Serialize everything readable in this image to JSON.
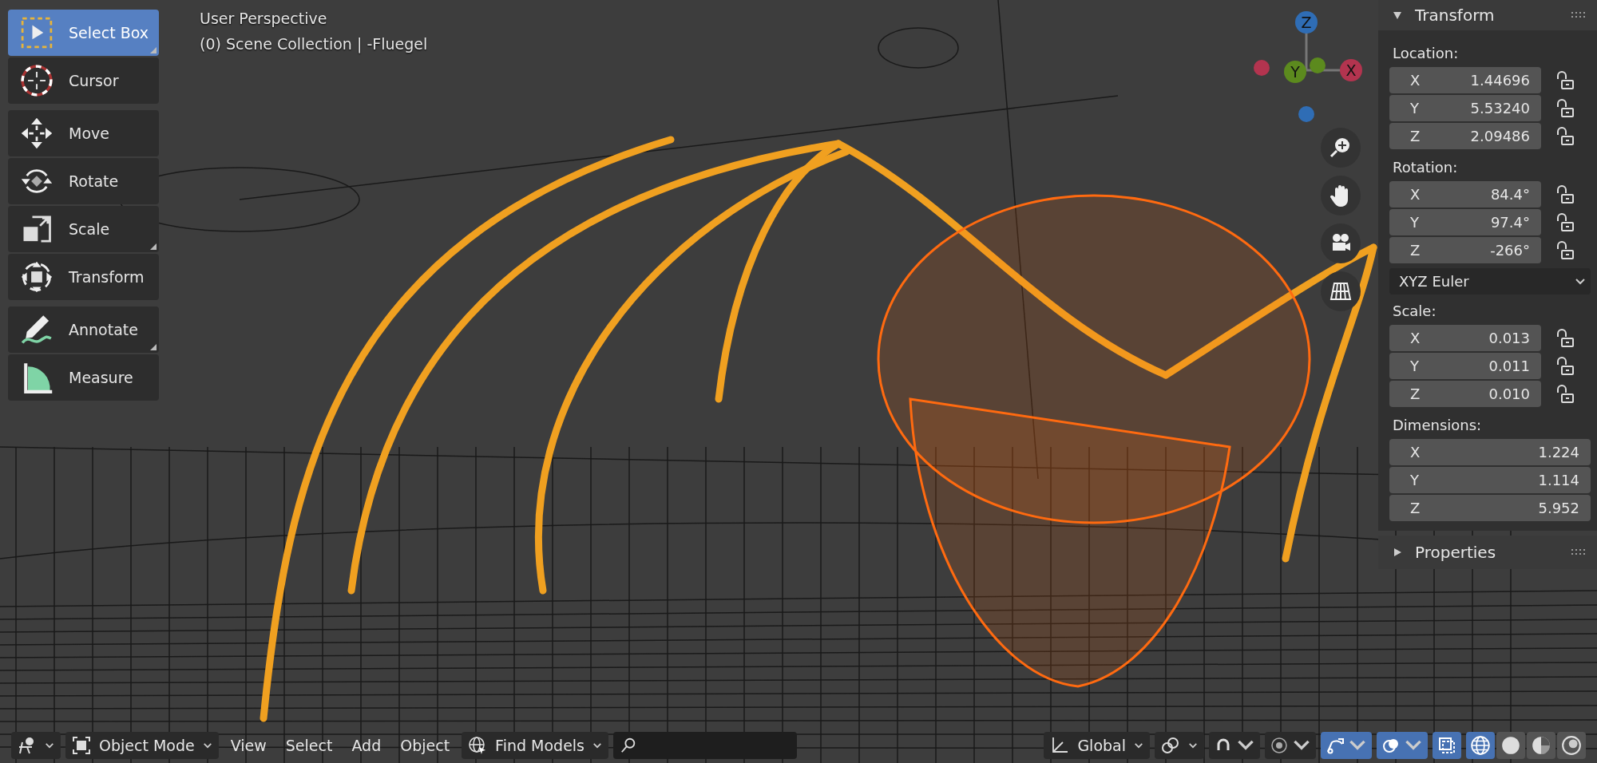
{
  "viewport": {
    "title": "User Perspective",
    "collection": "(0) Scene Collection | -Fluegel"
  },
  "tool_groups": [
    [
      {
        "label": "Select Box",
        "kind": "select",
        "selected": true,
        "submenu": true
      },
      {
        "label": "Cursor",
        "kind": "cursor",
        "selected": false,
        "submenu": false
      }
    ],
    [
      {
        "label": "Move",
        "kind": "move",
        "selected": false,
        "submenu": false
      },
      {
        "label": "Rotate",
        "kind": "rotate",
        "selected": false,
        "submenu": false
      },
      {
        "label": "Scale",
        "kind": "scale",
        "selected": false,
        "submenu": true
      },
      {
        "label": "Transform",
        "kind": "transform",
        "selected": false,
        "submenu": false
      }
    ],
    [
      {
        "label": "Annotate",
        "kind": "annotate",
        "selected": false,
        "submenu": true
      },
      {
        "label": "Measure",
        "kind": "measure",
        "selected": false,
        "submenu": false
      }
    ]
  ],
  "gizmo": {
    "axes": [
      {
        "label": "Z",
        "color": "#2f6db5"
      },
      {
        "label": "Y",
        "color": "#5c8a1e"
      },
      {
        "label": "X",
        "color": "#b3344f"
      }
    ]
  },
  "panel": {
    "title": "Transform",
    "expanded": true,
    "sections": [
      {
        "label": "Location:",
        "fields": [
          {
            "axis": "X",
            "value": "1.44696",
            "locked": false
          },
          {
            "axis": "Y",
            "value": "5.53240",
            "locked": false
          },
          {
            "axis": "Z",
            "value": "2.09486",
            "locked": false
          }
        ]
      },
      {
        "label": "Rotation:",
        "fields": [
          {
            "axis": "X",
            "value": "84.4°",
            "locked": false
          },
          {
            "axis": "Y",
            "value": "97.4°",
            "locked": false
          },
          {
            "axis": "Z",
            "value": "-266°",
            "locked": false
          }
        ],
        "mode": "XYZ Euler"
      },
      {
        "label": "Scale:",
        "fields": [
          {
            "axis": "X",
            "value": "0.013",
            "locked": false
          },
          {
            "axis": "Y",
            "value": "0.011",
            "locked": false
          },
          {
            "axis": "Z",
            "value": "0.010",
            "locked": false
          }
        ]
      },
      {
        "label": "Dimensions:",
        "fields": [
          {
            "axis": "X",
            "value": "1.224"
          },
          {
            "axis": "Y",
            "value": "1.114"
          },
          {
            "axis": "Z",
            "value": "5.952"
          }
        ]
      }
    ],
    "properties": {
      "title": "Properties",
      "expanded": false
    }
  },
  "header": {
    "mode": "Object Mode",
    "menus": [
      "View",
      "Select",
      "Add",
      "Object"
    ],
    "find_models": "Find Models",
    "orientation": "Global",
    "toggles": [
      {
        "kind": "snap",
        "on": false
      },
      {
        "kind": "proportional",
        "on": false
      },
      {
        "kind": "gizmo",
        "on": true
      },
      {
        "kind": "overlays",
        "on": true
      },
      {
        "kind": "xray",
        "on": true
      }
    ],
    "shading": [
      {
        "kind": "wireframe",
        "selected": true
      },
      {
        "kind": "solid",
        "selected": false
      },
      {
        "kind": "material",
        "selected": false
      },
      {
        "kind": "rendered",
        "selected": false
      }
    ]
  }
}
